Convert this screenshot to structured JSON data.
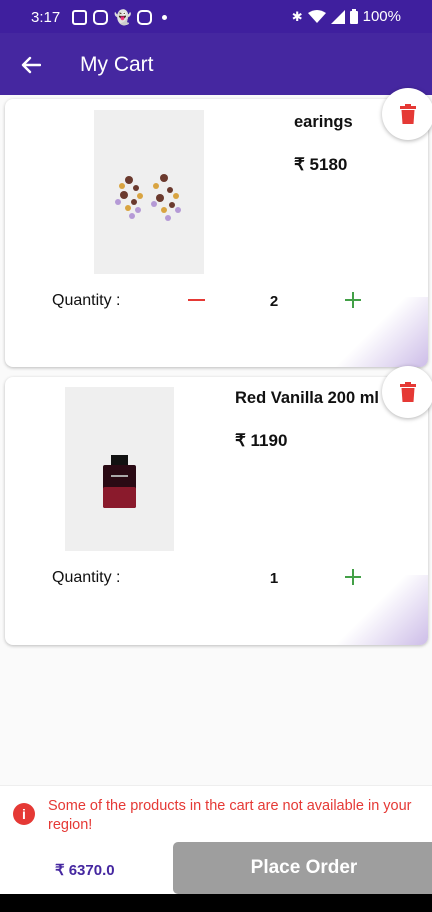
{
  "status_bar": {
    "time": "3:17",
    "battery": "100%",
    "icons": [
      "news-icon",
      "instagram-icon",
      "snapchat-icon",
      "instagram-icon",
      "bluetooth-icon",
      "wifi-icon",
      "signal-icon",
      "battery-icon"
    ]
  },
  "app_bar": {
    "title": "My Cart",
    "back_icon": "back-arrow-icon"
  },
  "cart": {
    "items": [
      {
        "name": "earings",
        "price": "₹ 5180",
        "quantity_label": "Quantity :",
        "quantity": "2",
        "image": "earrings-product-image"
      },
      {
        "name": "Red Vanilla 200 ml",
        "price": "₹ 1190",
        "quantity_label": "Quantity :",
        "quantity": "1",
        "image": "perfume-bottle-product-image"
      }
    ]
  },
  "footer": {
    "warning": "Some of the products in the cart are not available in your region!",
    "total": "₹ 6370.0",
    "place_order_label": "Place Order"
  },
  "colors": {
    "primary": "#4527a0",
    "status_bar": "#3f1f9e",
    "danger": "#e53935",
    "success": "#43a047",
    "disabled_button": "#9e9e9e"
  }
}
